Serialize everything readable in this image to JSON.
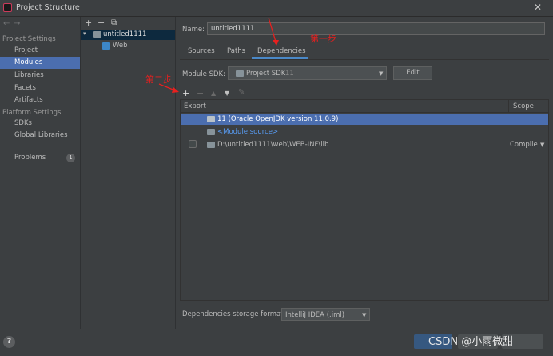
{
  "window": {
    "title": "Project Structure",
    "close_icon": "close-icon"
  },
  "nav": {
    "back": "←",
    "forward": "→"
  },
  "sidebar": {
    "project_settings_header": "Project Settings",
    "project_settings": [
      "Project",
      "Modules",
      "Libraries",
      "Facets",
      "Artifacts"
    ],
    "platform_settings_header": "Platform Settings",
    "platform_settings": [
      "SDKs",
      "Global Libraries"
    ],
    "problems_label": "Problems",
    "problems_count": "1",
    "selected": "Modules"
  },
  "module_tree": {
    "toolbar": {
      "add": "+",
      "remove": "−",
      "copy": "⧉"
    },
    "root_arrow": "▾",
    "root": "untitled1111",
    "child": "Web"
  },
  "details": {
    "name_label": "Name:",
    "name_value": "untitled1111",
    "tabs": [
      "Sources",
      "Paths",
      "Dependencies"
    ],
    "active_tab": "Dependencies",
    "module_sdk_label": "Module SDK:",
    "module_sdk_value": "Project SDK",
    "module_sdk_version": "11",
    "edit_button": "Edit",
    "dependency_toolbar": {
      "add": "+",
      "remove": "−",
      "up": "▲",
      "down": "▼",
      "edit": "✎"
    },
    "table": {
      "headers": {
        "export": "Export",
        "scope": "Scope"
      },
      "rows": [
        {
          "name": "11 (Oracle OpenJDK version 11.0.9)",
          "scope": ""
        },
        {
          "name": "<Module source>",
          "scope": ""
        },
        {
          "name": "D:\\untitled1111\\web\\WEB-INF\\lib",
          "scope": "Compile"
        }
      ]
    },
    "storage_format_label": "Dependencies storage format:",
    "storage_format_value": "IntelliJ IDEA (.iml)"
  },
  "annotations": {
    "step1": "第一步",
    "step2": "第二步"
  },
  "bottom": {
    "help": "?",
    "watermark": "CSDN @小雨微甜"
  },
  "colors": {
    "background": "#3c3f41",
    "selection": "#4b6eaf",
    "tab_underline": "#4a88c7",
    "link": "#589df6",
    "annotation": "#e8201f"
  }
}
